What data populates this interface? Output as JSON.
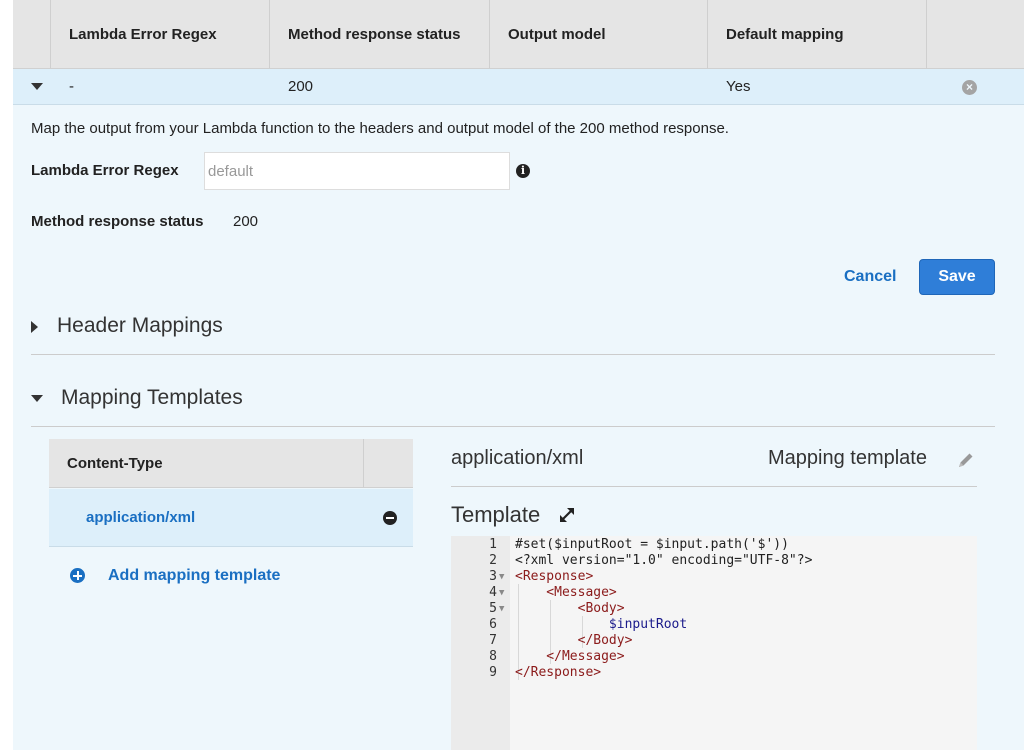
{
  "table": {
    "headers": [
      "Lambda Error Regex",
      "Method response status",
      "Output model",
      "Default mapping"
    ],
    "row": {
      "regex": "-",
      "status": "200",
      "output_model": "",
      "default_mapping": "Yes"
    }
  },
  "form": {
    "description": "Map the output from your Lambda function to the headers and output model of the 200 method response.",
    "regex_label": "Lambda Error Regex",
    "regex_placeholder": "default",
    "status_label": "Method response status",
    "status_value": "200",
    "cancel_label": "Cancel",
    "save_label": "Save"
  },
  "sections": {
    "header_mappings": "Header Mappings",
    "mapping_templates": "Mapping Templates"
  },
  "content_types": {
    "header": "Content-Type",
    "items": [
      "application/xml"
    ],
    "add_label": "Add mapping template"
  },
  "template_panel": {
    "content_type": "application/xml",
    "mapping_template_label": "Mapping template",
    "template_label": "Template"
  },
  "code_lines": [
    "#set($inputRoot = $input.path('$'))",
    "<?xml version=\"1.0\" encoding=\"UTF-8\"?>",
    "<Response>",
    "    <Message>",
    "        <Body>",
    "            $inputRoot",
    "        </Body>",
    "    </Message>",
    "</Response>"
  ],
  "line_numbers": [
    "1",
    "2",
    "3",
    "4",
    "5",
    "6",
    "7",
    "8",
    "9"
  ],
  "colors": {
    "accent": "#2f7ed8",
    "link": "#1a6fc2",
    "panel_bg": "#eef7fc"
  }
}
